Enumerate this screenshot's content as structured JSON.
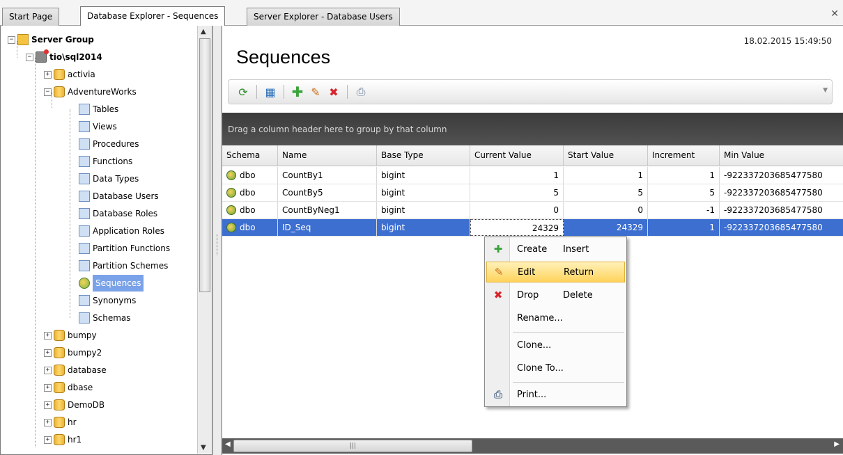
{
  "tabs": [
    {
      "label": "Start Page",
      "active": false
    },
    {
      "label": "Database Explorer - Sequences",
      "active": true
    },
    {
      "label": "Server Explorer - Database Users",
      "active": false
    }
  ],
  "tree": {
    "server_group": "Server Group",
    "server": "tio\\sql2014",
    "databases_before": [
      "activia"
    ],
    "expanded_db": "AdventureWorks",
    "objects": [
      "Tables",
      "Views",
      "Procedures",
      "Functions",
      "Data Types",
      "Database Users",
      "Database Roles",
      "Application Roles",
      "Partition Functions",
      "Partition Schemes",
      "Sequences",
      "Synonyms",
      "Schemas"
    ],
    "selected": "Sequences",
    "databases_after": [
      "bumpy",
      "bumpy2",
      "database",
      "dbase",
      "DemoDB",
      "hr",
      "hr1"
    ]
  },
  "main": {
    "title": "Sequences",
    "timestamp": "18.02.2015 15:49:50",
    "group_hint": "Drag a column header here to group by that column"
  },
  "toolbar": {
    "icons": [
      "refresh-icon",
      "properties-icon",
      "add-icon",
      "edit-icon",
      "delete-icon",
      "print-icon"
    ]
  },
  "grid": {
    "columns": [
      "Schema",
      "Name",
      "Base Type",
      "Current Value",
      "Start Value",
      "Increment",
      "Min Value"
    ],
    "rows": [
      [
        "dbo",
        "CountBy1",
        "bigint",
        "1",
        "1",
        "1",
        "-922337203685477580"
      ],
      [
        "dbo",
        "CountBy5",
        "bigint",
        "5",
        "5",
        "5",
        "-922337203685477580"
      ],
      [
        "dbo",
        "CountByNeg1",
        "bigint",
        "0",
        "0",
        "-1",
        "-922337203685477580"
      ],
      [
        "dbo",
        "ID_Seq",
        "bigint",
        "24329",
        "24329",
        "1",
        "-922337203685477580"
      ]
    ],
    "selected_row": 3
  },
  "context_menu": {
    "items": [
      {
        "label": "Create",
        "shortcut": "Insert",
        "icon": "add-icon"
      },
      {
        "label": "Edit",
        "shortcut": "Return",
        "icon": "edit-icon"
      },
      {
        "label": "Drop",
        "shortcut": "Delete",
        "icon": "delete-icon"
      },
      {
        "label": "Rename...",
        "shortcut": "",
        "icon": ""
      },
      {
        "label": "Clone...",
        "shortcut": "",
        "icon": ""
      },
      {
        "label": "Clone To...",
        "shortcut": "",
        "icon": ""
      },
      {
        "label": "Print...",
        "shortcut": "",
        "icon": "print-icon"
      }
    ],
    "highlighted": "Edit"
  },
  "colors": {
    "selection": "#3d6fd1",
    "tree_selection": "#7aa2e8",
    "group_panel": "#474747",
    "menu_highlight": "#ffd35c"
  }
}
